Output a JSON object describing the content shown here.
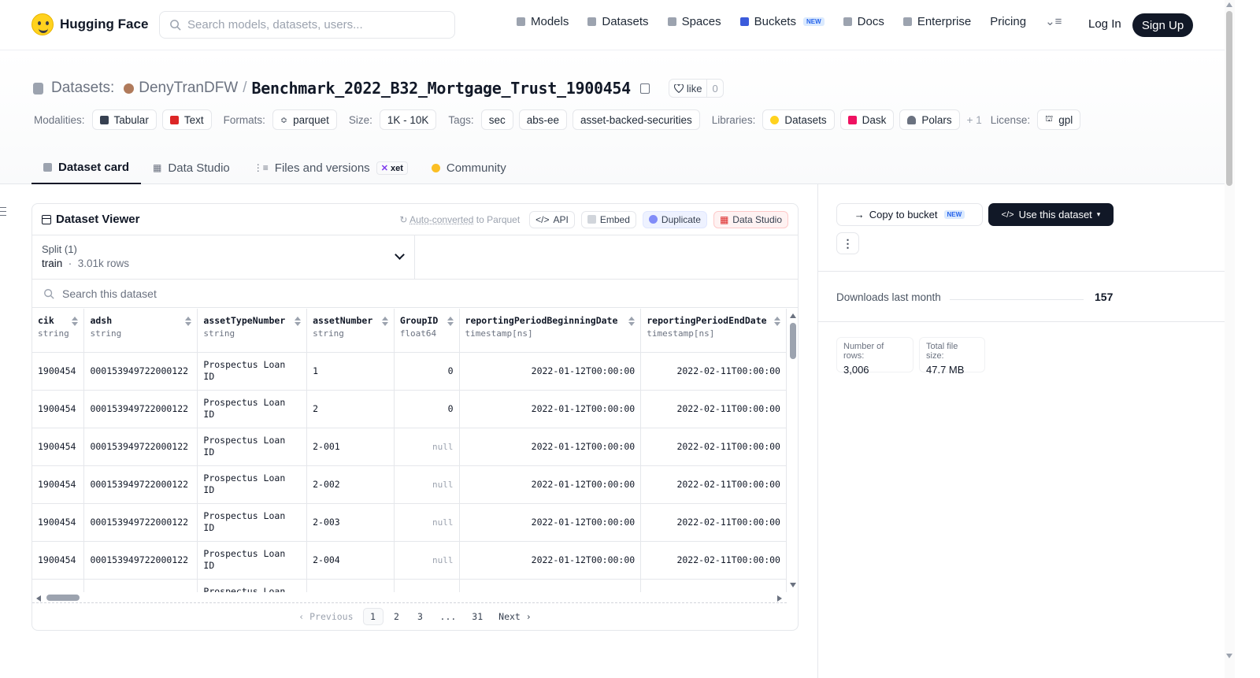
{
  "brand": {
    "name": "Hugging Face"
  },
  "search": {
    "placeholder": "Search models, datasets, users..."
  },
  "nav": {
    "items": [
      {
        "label": "Models",
        "icon": "cube-icon",
        "color": "#9ca3af"
      },
      {
        "label": "Datasets",
        "icon": "database-icon",
        "color": "#9ca3af"
      },
      {
        "label": "Spaces",
        "icon": "grid-icon",
        "color": "#9ca3af"
      },
      {
        "label": "Buckets",
        "icon": "bucket-icon",
        "color": "#3b5bdb",
        "badge": "NEW"
      },
      {
        "label": "Docs",
        "icon": "book-icon",
        "color": "#9ca3af"
      },
      {
        "label": "Enterprise",
        "icon": "building-icon",
        "color": "#9ca3af"
      },
      {
        "label": "Pricing"
      }
    ],
    "login": "Log In",
    "signup": "Sign Up"
  },
  "repo": {
    "type_label": "Datasets:",
    "owner": "DenyTranDFW",
    "name": "Benchmark_2022_B32_Mortgage_Trust_1900454",
    "like_label": "like",
    "likes": "0"
  },
  "tags": {
    "modalities_label": "Modalities:",
    "modalities": [
      {
        "label": "Tabular",
        "color": "#374151"
      },
      {
        "label": "Text",
        "color": "#dc2626"
      }
    ],
    "formats_label": "Formats:",
    "formats": [
      {
        "label": "parquet"
      }
    ],
    "size_label": "Size:",
    "size": "1K - 10K",
    "tags_label": "Tags:",
    "tags": [
      "sec",
      "abs-ee",
      "asset-backed-securities"
    ],
    "libraries_label": "Libraries:",
    "libraries": [
      {
        "label": "Datasets",
        "color": "#ffd21e"
      },
      {
        "label": "Dask",
        "color": "#ef1161"
      },
      {
        "label": "Polars",
        "color": "#6b7280"
      }
    ],
    "more": "+ 1",
    "license_label": "License:",
    "license": "gpl"
  },
  "tabs": [
    {
      "label": "Dataset card",
      "active": true
    },
    {
      "label": "Data Studio"
    },
    {
      "label": "Files and versions",
      "badge": "xet"
    },
    {
      "label": "Community"
    }
  ],
  "viewer": {
    "title": "Dataset Viewer",
    "auto_converted": "Auto-converted",
    "to_parquet": "to Parquet",
    "api": "API",
    "embed": "Embed",
    "duplicate": "Duplicate",
    "data_studio": "Data Studio",
    "split_label": "Split (1)",
    "split_value": "train",
    "split_rows": "3.01k rows",
    "search_placeholder": "Search this dataset",
    "columns": [
      {
        "name": "cik",
        "type": "string"
      },
      {
        "name": "adsh",
        "type": "string"
      },
      {
        "name": "assetTypeNumber",
        "type": "string"
      },
      {
        "name": "assetNumber",
        "type": "string"
      },
      {
        "name": "GroupID",
        "type": "float64"
      },
      {
        "name": "reportingPeriodBeginningDate",
        "type": "timestamp[ns]"
      },
      {
        "name": "reportingPeriodEndDate",
        "type": "timestamp[ns]"
      }
    ],
    "rows": [
      [
        "1900454",
        "0001539497220001​22",
        "Prospectus Loan ID",
        "1",
        "0",
        "2022-01-12T00:00:00",
        "2022-02-11T00:00:00"
      ],
      [
        "1900454",
        "000153949722000122",
        "Prospectus Loan ID",
        "2",
        "0",
        "2022-01-12T00:00:00",
        "2022-02-11T00:00:00"
      ],
      [
        "1900454",
        "000153949722000122",
        "Prospectus Loan ID",
        "2-001",
        "null",
        "2022-01-12T00:00:00",
        "2022-02-11T00:00:00"
      ],
      [
        "1900454",
        "000153949722000122",
        "Prospectus Loan ID",
        "2-002",
        "null",
        "2022-01-12T00:00:00",
        "2022-02-11T00:00:00"
      ],
      [
        "1900454",
        "000153949722000122",
        "Prospectus Loan ID",
        "2-003",
        "null",
        "2022-01-12T00:00:00",
        "2022-02-11T00:00:00"
      ],
      [
        "1900454",
        "000153949722000122",
        "Prospectus Loan ID",
        "2-004",
        "null",
        "2022-01-12T00:00:00",
        "2022-02-11T00:00:00"
      ],
      [
        "",
        "",
        "Prospectus Loan",
        "",
        "",
        "",
        ""
      ]
    ],
    "pagination": {
      "previous": "Previous",
      "pages": [
        "1",
        "2",
        "3",
        "...",
        "31"
      ],
      "current": "1",
      "next": "Next"
    }
  },
  "sidebar": {
    "copy_to_bucket": "Copy to bucket",
    "copy_badge": "NEW",
    "use_dataset": "Use this dataset",
    "more": "⋮",
    "downloads_label": "Downloads last month",
    "downloads": "157",
    "stats": [
      {
        "label": "Number of rows:",
        "value": "3,006"
      },
      {
        "label": "Total file size:",
        "value": "47.7 MB"
      }
    ]
  }
}
